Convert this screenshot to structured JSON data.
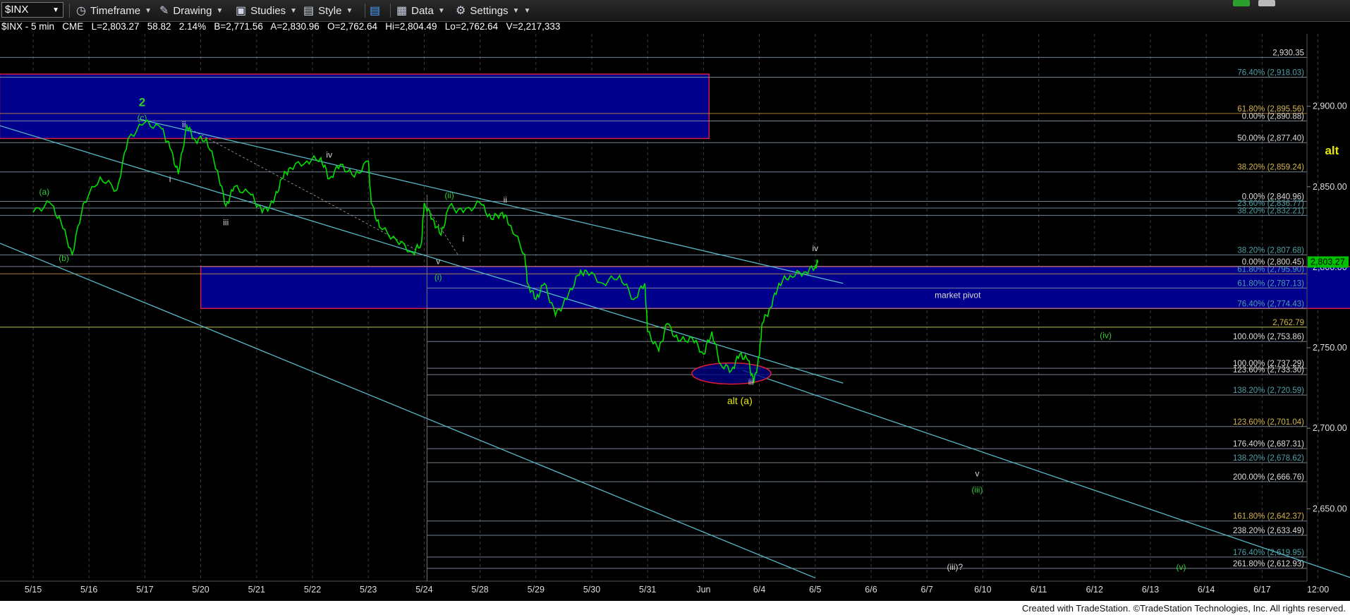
{
  "toolbar": {
    "symbol": "$INX",
    "items": [
      {
        "name": "timeframe-menu",
        "label": "Timeframe",
        "icon": "clock-icon"
      },
      {
        "name": "drawing-menu",
        "label": "Drawing",
        "icon": "pencil-icon"
      },
      {
        "name": "studies-menu",
        "label": "Studies",
        "icon": "studies-icon"
      },
      {
        "name": "style-menu",
        "label": "Style",
        "icon": "style-icon"
      },
      {
        "name": "data-menu",
        "label": "Data",
        "icon": "data-icon"
      },
      {
        "name": "settings-menu",
        "label": "Settings",
        "icon": "gear-icon"
      }
    ]
  },
  "info": {
    "symbol": "$INX - 5 min",
    "exchange": "CME",
    "last": "L=2,803.27",
    "change": "58.82",
    "pct": "2.14%",
    "bid": "B=2,771.56",
    "ask": "A=2,830.96",
    "open": "O=2,762.64",
    "high": "Hi=2,804.49",
    "low": "Lo=2,762.64",
    "volume": "V=2,217,333"
  },
  "footer": "Created with TradeStation. ©TradeStation Technologies, Inc. All rights reserved.",
  "colors": {
    "price": "#00e000",
    "trend": "#58b8c8",
    "zone": "#00008c",
    "zoneBorder": "#d02040",
    "fibLabel": "#4fa0a8",
    "fibGold": "#d4b44a",
    "green": "#33cc33",
    "yellow": "#e6e600",
    "white": "#ffffff"
  },
  "chart_data": {
    "type": "line",
    "title": "$INX - 5 min",
    "x": [
      "5/15",
      "5/16",
      "5/17",
      "5/20",
      "5/21",
      "5/22",
      "5/23",
      "5/24",
      "5/28",
      "5/29",
      "5/30",
      "5/31",
      "Jun",
      "6/4",
      "6/5",
      "6/6",
      "6/7",
      "6/10",
      "6/11",
      "6/12",
      "6/13",
      "6/14",
      "6/17",
      "12:00"
    ],
    "ylim": [
      2605,
      2945
    ],
    "y_ticks": [
      2650,
      2700,
      2750,
      2800,
      2850,
      2900
    ],
    "y_tick_labels": [
      "2,650.00",
      "2,700.00",
      "2,750.00",
      "2,800.00",
      "2,850.00",
      "2,900.00"
    ],
    "last_price": 2803.27,
    "last_price_label": "2,803.27",
    "series": [
      {
        "values": [
          [
            0,
            2834
          ],
          [
            0.3,
            2840
          ],
          [
            0.5,
            2828
          ],
          [
            0.7,
            2808
          ],
          [
            0.9,
            2840
          ],
          [
            1.2,
            2856
          ],
          [
            1.5,
            2848
          ],
          [
            1.7,
            2880
          ],
          [
            2.0,
            2890
          ],
          [
            2.3,
            2886
          ],
          [
            2.45,
            2874
          ],
          [
            2.6,
            2858
          ],
          [
            2.75,
            2888
          ],
          [
            2.9,
            2879
          ],
          [
            3.1,
            2880
          ],
          [
            3.3,
            2860
          ],
          [
            3.45,
            2838
          ],
          [
            3.6,
            2850
          ],
          [
            3.9,
            2845
          ],
          [
            4.1,
            2834
          ],
          [
            4.3,
            2840
          ],
          [
            4.45,
            2855
          ],
          [
            4.6,
            2862
          ],
          [
            4.9,
            2866
          ],
          [
            5.15,
            2868
          ],
          [
            5.3,
            2855
          ],
          [
            5.5,
            2864
          ],
          [
            5.75,
            2856
          ],
          [
            6.0,
            2866
          ],
          [
            6.05,
            2840
          ],
          [
            6.2,
            2825
          ],
          [
            6.5,
            2817
          ],
          [
            6.8,
            2809
          ],
          [
            6.95,
            2815
          ],
          [
            7.0,
            2840
          ],
          [
            7.15,
            2830
          ],
          [
            7.3,
            2820
          ],
          [
            7.45,
            2838
          ],
          [
            7.7,
            2834
          ],
          [
            8.0,
            2840
          ],
          [
            8.2,
            2830
          ],
          [
            8.4,
            2834
          ],
          [
            8.55,
            2826
          ],
          [
            8.8,
            2808
          ],
          [
            8.85,
            2790
          ],
          [
            9.0,
            2780
          ],
          [
            9.15,
            2790
          ],
          [
            9.35,
            2770
          ],
          [
            9.55,
            2780
          ],
          [
            9.75,
            2795
          ],
          [
            9.9,
            2798
          ],
          [
            10.2,
            2790
          ],
          [
            10.5,
            2795
          ],
          [
            10.75,
            2780
          ],
          [
            10.95,
            2790
          ],
          [
            11.0,
            2760
          ],
          [
            11.2,
            2748
          ],
          [
            11.35,
            2765
          ],
          [
            11.55,
            2754
          ],
          [
            11.8,
            2756
          ],
          [
            12.0,
            2746
          ],
          [
            12.15,
            2760
          ],
          [
            12.3,
            2740
          ],
          [
            12.5,
            2736
          ],
          [
            12.65,
            2746
          ],
          [
            12.8,
            2742
          ],
          [
            12.9,
            2728
          ],
          [
            13.0,
            2745
          ],
          [
            13.05,
            2765
          ],
          [
            13.2,
            2775
          ],
          [
            13.35,
            2790
          ],
          [
            13.55,
            2795
          ],
          [
            13.8,
            2797
          ],
          [
            14.0,
            2800
          ],
          [
            14.05,
            2804
          ]
        ]
      }
    ],
    "fib_levels": [
      {
        "value": 2930.35,
        "label": "2,930.35"
      },
      {
        "value": 2918.03,
        "label": "76.40% (2,918.03)"
      },
      {
        "value": 2895.56,
        "label": "61.80% (2,895.56)"
      },
      {
        "value": 2890.88,
        "label": "0.00% (2,890.88)"
      },
      {
        "value": 2877.4,
        "label": "50.00% (2,877.40)"
      },
      {
        "value": 2859.24,
        "label": "38.20% (2,859.24)"
      },
      {
        "value": 2840.96,
        "label": "0.00% (2,840.96)"
      },
      {
        "value": 2836.77,
        "label": "23.60% (2,836.77)"
      },
      {
        "value": 2832.21,
        "label": "38.20% (2,832.21)"
      },
      {
        "value": 2807.68,
        "label": "38.20% (2,807.68)"
      },
      {
        "value": 2800.45,
        "label": "0.00% (2,800.45)"
      },
      {
        "value": 2795.9,
        "label": "61.80% (2,795.90)"
      },
      {
        "value": 2787.13,
        "label": "61.80% (2,787.13)"
      },
      {
        "value": 2774.43,
        "label": "76.40% (2,774.43)"
      },
      {
        "value": 2762.79,
        "label": "2,762.79"
      },
      {
        "value": 2753.86,
        "label": "100.00% (2,753.86)"
      },
      {
        "value": 2737.29,
        "label": "100.00% (2,737.29)"
      },
      {
        "value": 2733.3,
        "label": "123.60% (2,733.30)"
      },
      {
        "value": 2720.59,
        "label": "138.20% (2,720.59)"
      },
      {
        "value": 2701.04,
        "label": "123.60% (2,701.04)"
      },
      {
        "value": 2687.31,
        "label": "176.40% (2,687.31)"
      },
      {
        "value": 2678.62,
        "label": "138.20% (2,678.62)"
      },
      {
        "value": 2666.76,
        "label": "200.00% (2,666.76)"
      },
      {
        "value": 2642.37,
        "label": "161.80% (2,642.37)"
      },
      {
        "value": 2633.49,
        "label": "238.20% (2,633.49)"
      },
      {
        "value": 2619.95,
        "label": "176.40% (2,619.95)"
      },
      {
        "value": 2612.93,
        "label": "261.80% (2,612.93)"
      }
    ],
    "zones": [
      {
        "x0": -0.6,
        "x1": 12.1,
        "top": 2920,
        "bottom": 2880
      },
      {
        "x0": 3.0,
        "x1": 23.6,
        "top": 2800.45,
        "bottom": 2774.43
      }
    ],
    "wave_labels": [
      {
        "text": "2",
        "x": 1.95,
        "value": 2900,
        "color": "green"
      },
      {
        "text": "(c)",
        "x": 1.95,
        "value": 2891,
        "color": "green"
      },
      {
        "text": "ii",
        "x": 2.7,
        "value": 2887,
        "color": "white"
      },
      {
        "text": "(a)",
        "x": 0.2,
        "value": 2845,
        "color": "green"
      },
      {
        "text": "(b)",
        "x": 0.55,
        "value": 2804,
        "color": "green"
      },
      {
        "text": "i",
        "x": 2.45,
        "value": 2853,
        "color": "white"
      },
      {
        "text": "iii",
        "x": 3.45,
        "value": 2826,
        "color": "white"
      },
      {
        "text": "iv",
        "x": 5.3,
        "value": 2868,
        "color": "white"
      },
      {
        "text": "(ii)",
        "x": 7.45,
        "value": 2843,
        "color": "green"
      },
      {
        "text": "ii",
        "x": 8.45,
        "value": 2840,
        "color": "white"
      },
      {
        "text": "i",
        "x": 7.7,
        "value": 2816,
        "color": "white"
      },
      {
        "text": "v",
        "x": 7.25,
        "value": 2802,
        "color": "white"
      },
      {
        "text": "(i)",
        "x": 7.25,
        "value": 2792,
        "color": "green"
      },
      {
        "text": "iv",
        "x": 14.0,
        "value": 2810,
        "color": "white"
      },
      {
        "text": "market pivot",
        "x": 16.55,
        "value": 2781,
        "color": "white"
      },
      {
        "text": "iii",
        "x": 12.85,
        "value": 2727,
        "color": "white"
      },
      {
        "text": "alt (a)",
        "x": 12.65,
        "value": 2715,
        "color": "yellow"
      },
      {
        "text": "(iv)",
        "x": 19.2,
        "value": 2756,
        "color": "green"
      },
      {
        "text": "v",
        "x": 16.9,
        "value": 2670,
        "color": "white"
      },
      {
        "text": "(iii)",
        "x": 16.9,
        "value": 2660,
        "color": "green"
      },
      {
        "text": "(iii)?",
        "x": 16.5,
        "value": 2612,
        "color": "white"
      },
      {
        "text": "(v)",
        "x": 20.55,
        "value": 2612,
        "color": "green"
      },
      {
        "text": "alt",
        "x": 23.25,
        "value": 2870,
        "color": "yellow"
      }
    ]
  }
}
